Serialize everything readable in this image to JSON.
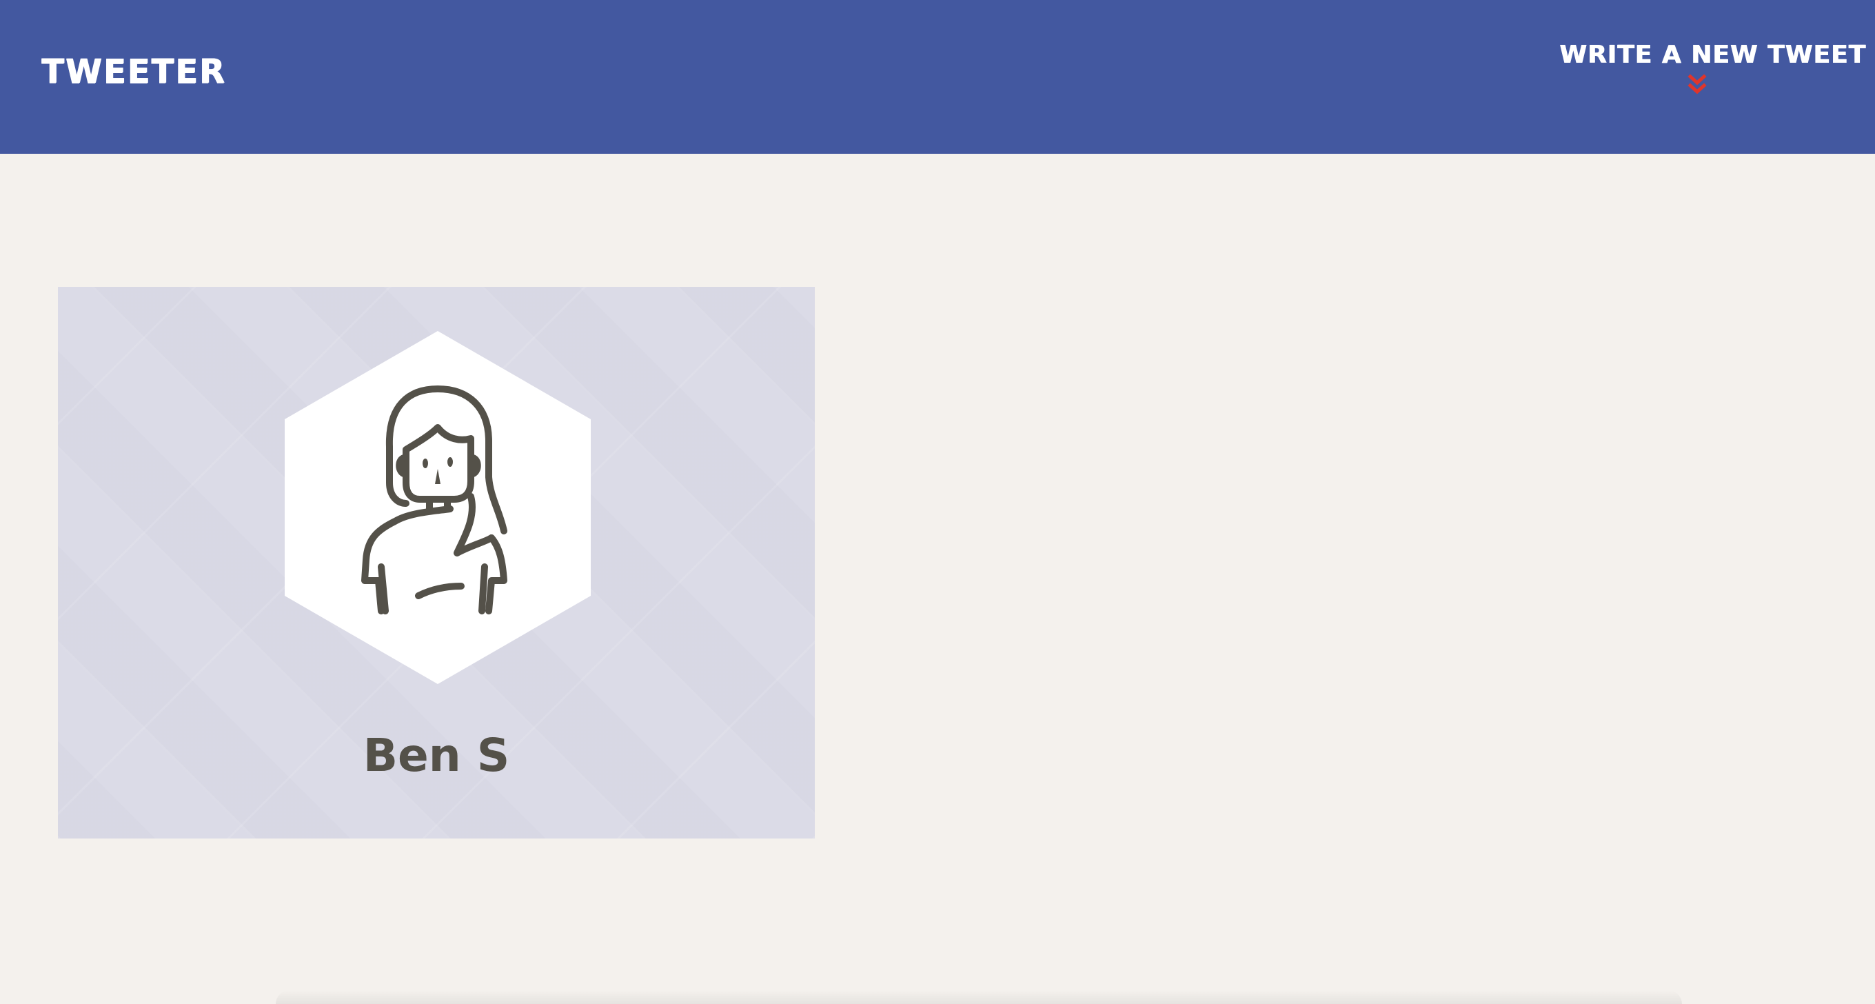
{
  "nav": {
    "brand": "tweeter",
    "compose_label": "Write a new tweet",
    "compose_icon": "double-chevron-down-icon"
  },
  "profile": {
    "name": "Ben S",
    "avatar_icon": "user-avatar-icon"
  },
  "colors": {
    "navbar": "#4358a0",
    "page_background": "#f4f1ed",
    "card_background": "#dbdbe7",
    "accent": "#e0352b",
    "text": "#545149"
  }
}
